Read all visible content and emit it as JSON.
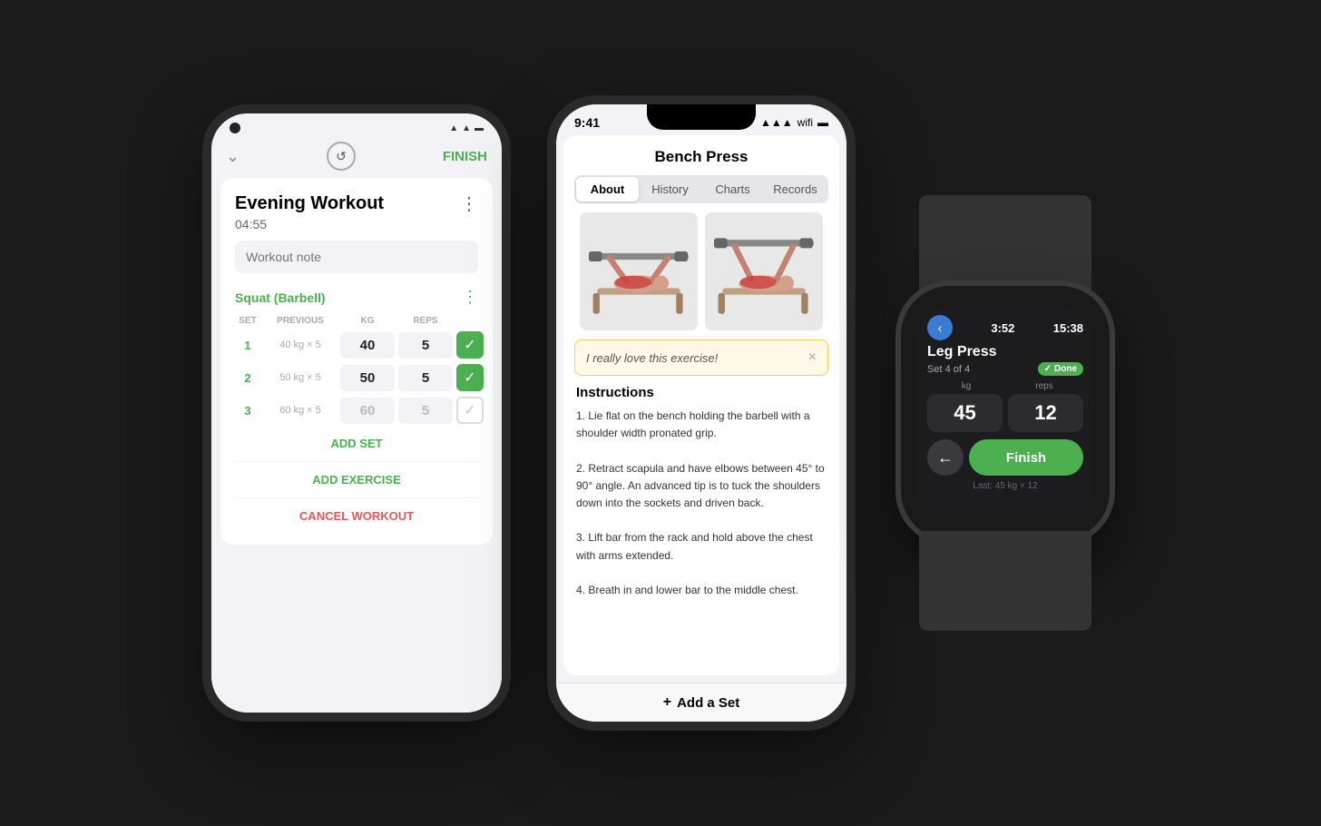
{
  "background": "#1a1a1a",
  "phone1": {
    "status": {
      "icons": "▲ ◀ ▬"
    },
    "header": {
      "finish_label": "FINISH",
      "refresh_icon": "↺"
    },
    "workout": {
      "name": "Evening Workout",
      "timer": "04:55",
      "note_placeholder": "Workout note",
      "more_icon": "⋮"
    },
    "exercise": {
      "name": "Squat (Barbell)",
      "more_icon": "⋮"
    },
    "table": {
      "headers": [
        "SET",
        "PREVIOUS",
        "KG",
        "REPS",
        ""
      ],
      "rows": [
        {
          "num": "1",
          "prev": "40 kg × 5",
          "kg": "40",
          "reps": "5",
          "checked": true
        },
        {
          "num": "2",
          "prev": "50 kg × 5",
          "kg": "50",
          "reps": "5",
          "checked": true
        },
        {
          "num": "3",
          "prev": "60 kg × 5",
          "kg": "60",
          "reps": "5",
          "checked": false
        }
      ]
    },
    "add_set_label": "ADD SET",
    "add_exercise_label": "ADD EXERCISE",
    "cancel_label": "CANCEL WORKOUT"
  },
  "phone2": {
    "status": {
      "time": "9:41",
      "battery_icon": "🔋"
    },
    "exercise_title": "Bench Press",
    "tabs": [
      {
        "label": "About",
        "active": true
      },
      {
        "label": "History",
        "active": false
      },
      {
        "label": "Charts",
        "active": false
      },
      {
        "label": "Records",
        "active": false
      }
    ],
    "note": {
      "text": "I really love this exercise!",
      "close_icon": "×"
    },
    "instructions": {
      "title": "Instructions",
      "steps": [
        "1. Lie flat on the bench holding the barbell with a shoulder width pronated grip.",
        "2. Retract scapula and have elbows between 45° to 90° angle. An advanced tip is to tuck the shoulders down into the sockets and driven back.",
        "3. Lift bar from the rack and hold above the chest with arms extended.",
        "4. Breath in and lower bar to the middle chest."
      ]
    },
    "bottom_bar": {
      "icon": "+",
      "label": "Add a Set"
    }
  },
  "watch": {
    "back_icon": "‹",
    "timer": "3:52",
    "clock": "15:38",
    "exercise_name": "Leg Press",
    "set_info": "Set 4 of 4",
    "done_label": "Done",
    "done_check": "✓",
    "labels": {
      "kg": "kg",
      "reps": "reps"
    },
    "kg_value": "45",
    "reps_value": "12",
    "back_arrow": "←",
    "finish_label": "Finish",
    "last_text": "Last: 45 kg × 12"
  }
}
